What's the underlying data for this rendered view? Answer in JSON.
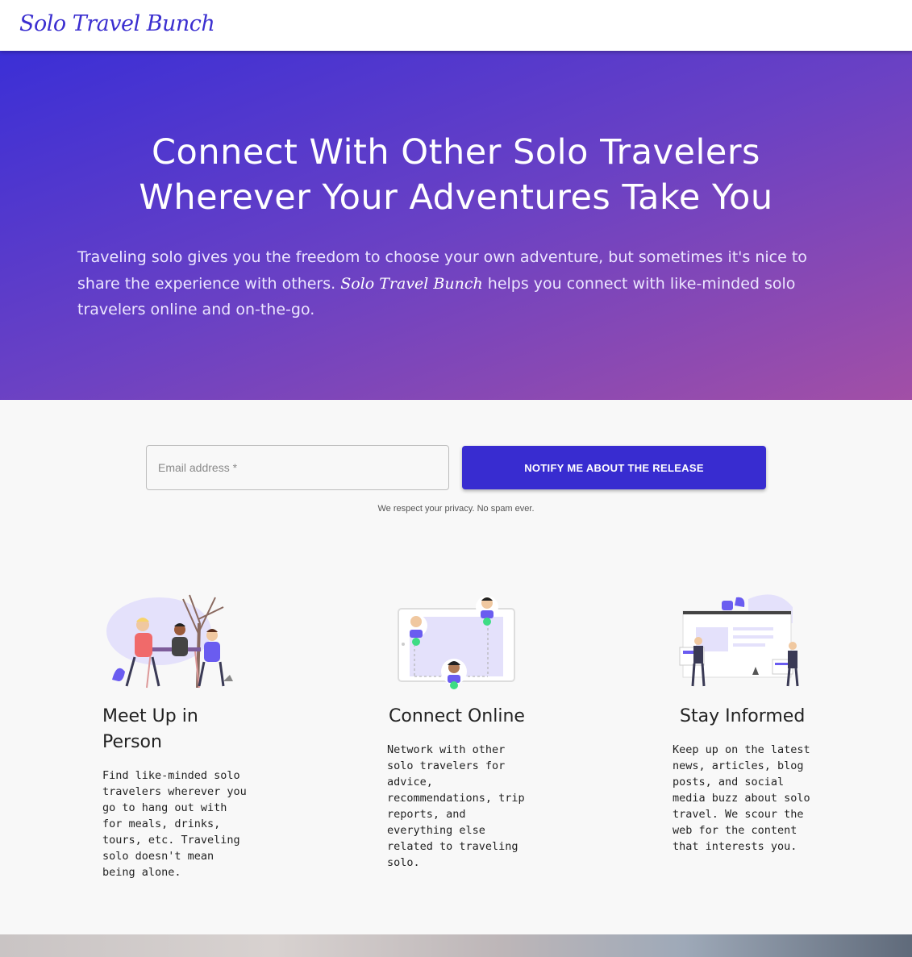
{
  "nav": {
    "brand": "Solo Travel Bunch"
  },
  "hero": {
    "title_line1": "Connect With Other Solo Travelers",
    "title_line2": "Wherever Your Adventures Take You",
    "desc_before": "Traveling solo gives you the freedom to choose your own adventure, but sometimes it's nice to share the experience with others. ",
    "desc_brand": "Solo Travel Bunch",
    "desc_after": " helps you connect with like-minded solo travelers online and on-the-go."
  },
  "signup": {
    "email_placeholder": "Email address *",
    "email_value": "",
    "button_label": "NOTIFY ME ABOUT THE RELEASE",
    "privacy_note": "We respect your privacy. No spam ever."
  },
  "features": [
    {
      "title": "Meet Up in Person",
      "text": "Find like-minded solo travelers wherever you go to hang out with for meals, drinks, tours, etc. Traveling solo doesn't mean being alone.",
      "icon": "people-meetup-illustration"
    },
    {
      "title": "Connect Online",
      "text": "Network with other solo travelers for advice, recommendations, trip reports, and everything else related to traveling solo.",
      "icon": "online-network-illustration"
    },
    {
      "title": "Stay Informed",
      "text": "Keep up on the latest news, articles, blog posts, and social media buzz about solo travel. We scour the web for the content that interests you.",
      "icon": "news-board-illustration"
    }
  ],
  "colors": {
    "brand": "#3b2fd0",
    "button": "#382cd0",
    "gradient_start": "#3b2fd6",
    "gradient_end": "#a24fa6",
    "accent_light": "#e4e1fb",
    "check_green": "#3ddc84"
  }
}
